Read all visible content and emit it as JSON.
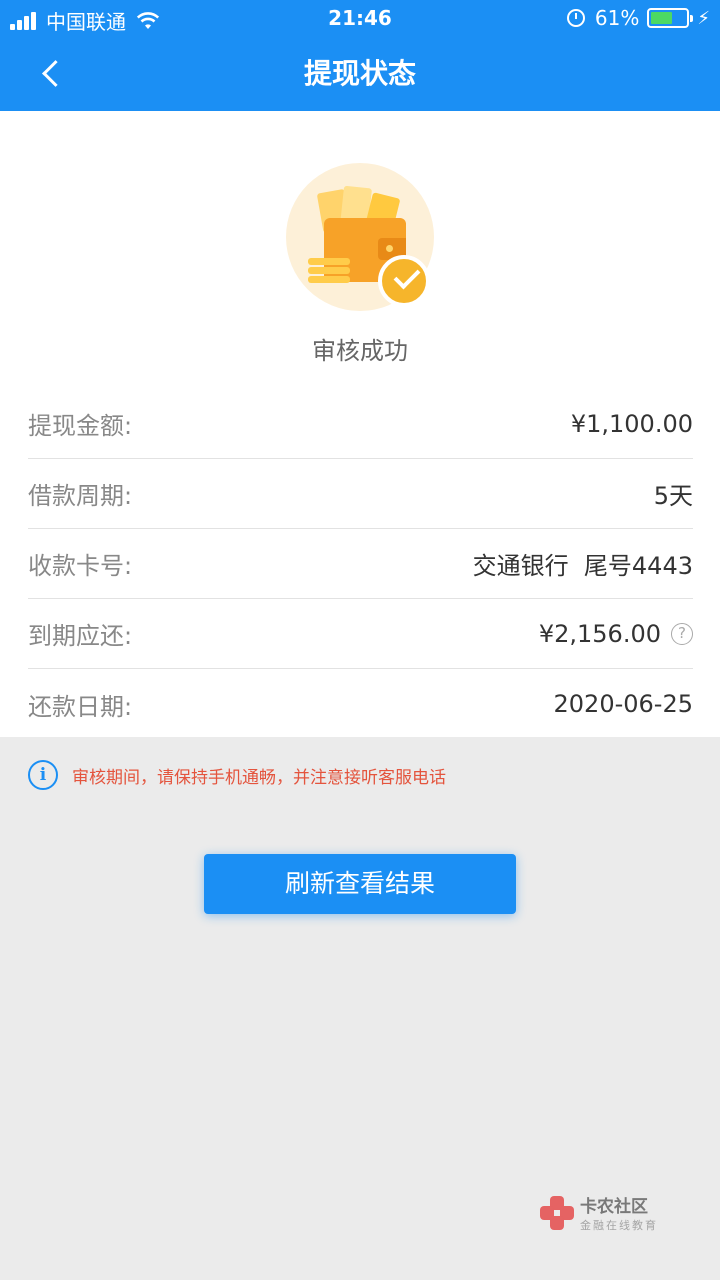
{
  "status_bar": {
    "carrier": "中国联通",
    "time": "21:46",
    "battery_percent": "61%",
    "battery_level": 0.61
  },
  "nav": {
    "title": "提现状态"
  },
  "result": {
    "status": "审核成功"
  },
  "details": [
    {
      "label": "提现金额:",
      "value": "¥1,100.00"
    },
    {
      "label": "借款周期:",
      "value": "5天"
    },
    {
      "label": "收款卡号:",
      "value": "交通银行  尾号4443"
    },
    {
      "label": "到期应还:",
      "value": "¥2,156.00"
    },
    {
      "label": "还款日期:",
      "value": "2020-06-25"
    }
  ],
  "help_glyph": "?",
  "notice": {
    "icon": "info-icon",
    "glyph": "i",
    "text": "审核期间，请保持手机通畅，并注意接听客服电话"
  },
  "refresh_button": {
    "label": "刷新查看结果"
  },
  "watermark": {
    "title": "卡农社区",
    "subtitle": "金融在线教育"
  },
  "colors": {
    "primary": "#1b8ff4",
    "notice": "#e4543d",
    "wallet": "#f7a228",
    "check": "#f6b52b"
  }
}
